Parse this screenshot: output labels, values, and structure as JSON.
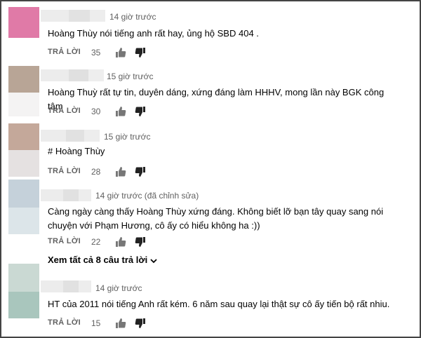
{
  "comments": [
    {
      "time": "14 giờ trước",
      "text": "Hoàng Thùy nói tiếng anh rất hay, ủng hộ SBD 404 .",
      "reply_label": "TRẢ LỜI",
      "likes": "35",
      "avatar_colors": [
        "#e07aa7",
        "#ffffff"
      ]
    },
    {
      "time": "15 giờ trước",
      "text": "Hoàng Thuỳ rất tự tin, duyên dáng, xứng đáng làm HHHV, mong lần này BGK công tâm",
      "reply_label": "TRẢ LỜI",
      "likes": "30",
      "avatar_colors": [
        "#b8a596",
        "#f4f3f3"
      ]
    },
    {
      "time": "15 giờ trước",
      "text": "# Hoàng Thùy",
      "reply_label": "TRẢ LỜI",
      "likes": "28",
      "avatar_colors": [
        "#c4a89a",
        "#e5e1e1"
      ]
    },
    {
      "time": "14 giờ trước (đã chỉnh sửa)",
      "text": "Càng ngày càng thấy Hoàng Thùy xứng đáng. Không biết lỡ bạn tây quay sang nói chuyện với Phạm Hương, cô ấy có hiểu không ha :))",
      "reply_label": "TRẢ LỜI",
      "likes": "22",
      "avatar_colors": [
        "#c5d1da",
        "#dce5e9"
      ]
    },
    {
      "time": "14 giờ trước",
      "text": "HT của 2011 nói tiếng Anh rất kém. 6 năm sau quay lại thật sự cô ấy tiến bộ rất nhiu.",
      "reply_label": "TRẢ LỜI",
      "likes": "15",
      "avatar_colors": [
        "#cad9d3",
        "#a9c6bd"
      ]
    }
  ],
  "view_all_replies": "Xem tất cả 8 câu trả lời",
  "colors": {
    "meta": "#606060",
    "text": "#030303",
    "border": "#444444"
  },
  "icons": {
    "like": "thumbs-up-icon",
    "dislike": "thumbs-down-icon",
    "expand": "chevron-down-icon"
  }
}
